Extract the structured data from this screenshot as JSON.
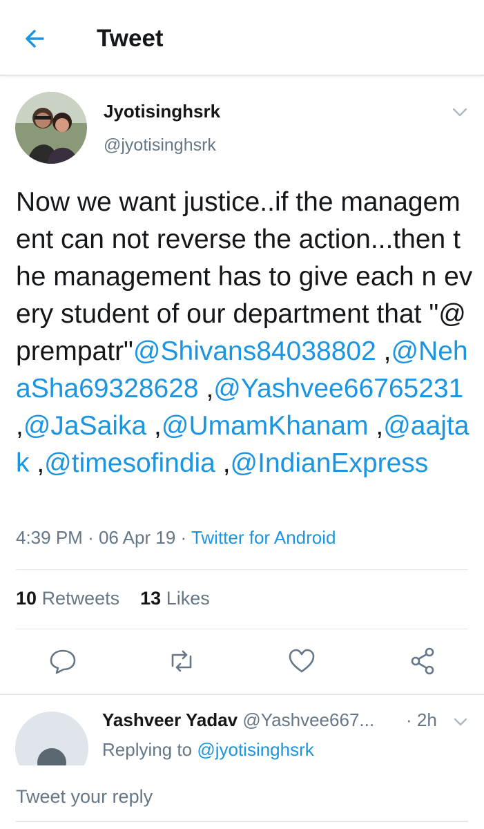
{
  "header": {
    "title": "Tweet",
    "back_icon": "back-arrow-icon"
  },
  "colors": {
    "link": "#1b95e0",
    "secondary": "#657786",
    "text": "#14171a",
    "divider": "#e1e8ed"
  },
  "tweet": {
    "author": {
      "name": "Jyotisinghsrk",
      "handle": "@jyotisinghsrk"
    },
    "text_plain": "Now we want justice..if the management can not reverse the action...then the management has to give each n every student of our department that \"@prempatr\"",
    "mentions": [
      {
        "text": "@Shivans84038802",
        "sep": " ,"
      },
      {
        "text": "@NehaSha69328628",
        "sep": " ,"
      },
      {
        "text": "@Yashvee66765231",
        "sep": " ,"
      },
      {
        "text": "@JaSaika",
        "sep": " ,"
      },
      {
        "text": "@UmamKhanam",
        "sep": " ,"
      },
      {
        "text": "@aajtak",
        "sep": " ,"
      },
      {
        "text": "@timesofindia",
        "sep": " ,"
      },
      {
        "text": "@IndianExpress",
        "sep": ""
      }
    ],
    "time": "4:39 PM",
    "date": "06 Apr 19",
    "source": "Twitter for Android",
    "dot": "·",
    "retweets_count": "10",
    "retweets_label": "Retweets",
    "likes_count": "13",
    "likes_label": "Likes"
  },
  "actions": [
    "reply-icon",
    "retweet-icon",
    "like-icon",
    "share-icon"
  ],
  "reply": {
    "name": "Yashveer Yadav",
    "handle": "@Yashvee667...",
    "time": "· 2h",
    "replying_prefix": "Replying to",
    "replying_to": "@jyotisinghsrk"
  },
  "composer": {
    "placeholder": "Tweet your reply"
  }
}
